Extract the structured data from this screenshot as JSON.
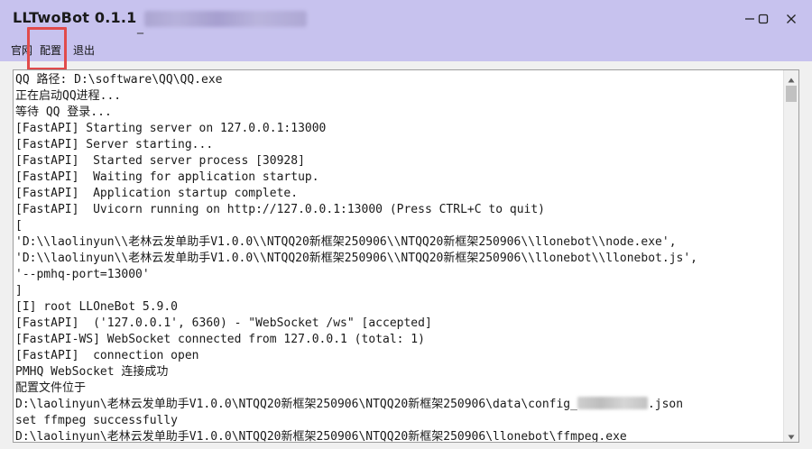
{
  "window": {
    "title": "LLTwoBot 0.1.1",
    "title_separator": "_",
    "controls": {
      "minimize_icon": "minimize-icon",
      "maximize_icon": "maximize-icon",
      "close_icon": "close-icon"
    }
  },
  "menu": {
    "items": [
      "官网",
      "配置",
      "退出"
    ],
    "highlighted": "配置"
  },
  "log": {
    "lines": [
      "QQ 路径: D:\\software\\QQ\\QQ.exe",
      "正在启动QQ进程...",
      "等待 QQ 登录...",
      "[FastAPI] Starting server on 127.0.0.1:13000",
      "[FastAPI] Server starting...",
      "[FastAPI]  Started server process [30928]",
      "[FastAPI]  Waiting for application startup.",
      "[FastAPI]  Application startup complete.",
      "[FastAPI]  Uvicorn running on http://127.0.0.1:13000 (Press CTRL+C to quit)",
      "[",
      "'D:\\\\laolinyun\\\\老林云发单助手V1.0.0\\\\NTQQ20新框架250906\\\\NTQQ20新框架250906\\\\llonebot\\\\node.exe',",
      "'D:\\\\laolinyun\\\\老林云发单助手V1.0.0\\\\NTQQ20新框架250906\\\\NTQQ20新框架250906\\\\llonebot\\\\llonebot.js',",
      "'--pmhq-port=13000'",
      "]",
      "[I] root LLOneBot 5.9.0",
      "[FastAPI]  ('127.0.0.1', 6360) - \"WebSocket /ws\" [accepted]",
      "[FastAPI-WS] WebSocket connected from 127.0.0.1 (total: 1)",
      "[FastAPI]  connection open",
      "PMHQ WebSocket 连接成功",
      "配置文件位于",
      "D:\\laolinyun\\老林云发单助手V1.0.0\\NTQQ20新框架250906\\NTQQ20新框架250906\\data\\config_",
      "set ffmpeg successfully",
      "D:\\laolinyun\\老林云发单助手V1.0.0\\NTQQ20新框架250906\\NTQQ20新框架250906\\llonebot\\ffmpeg.exe"
    ],
    "config_suffix": ".json"
  },
  "colors": {
    "titlebar": "#c7c2ee",
    "highlight": "#e14b4b"
  }
}
